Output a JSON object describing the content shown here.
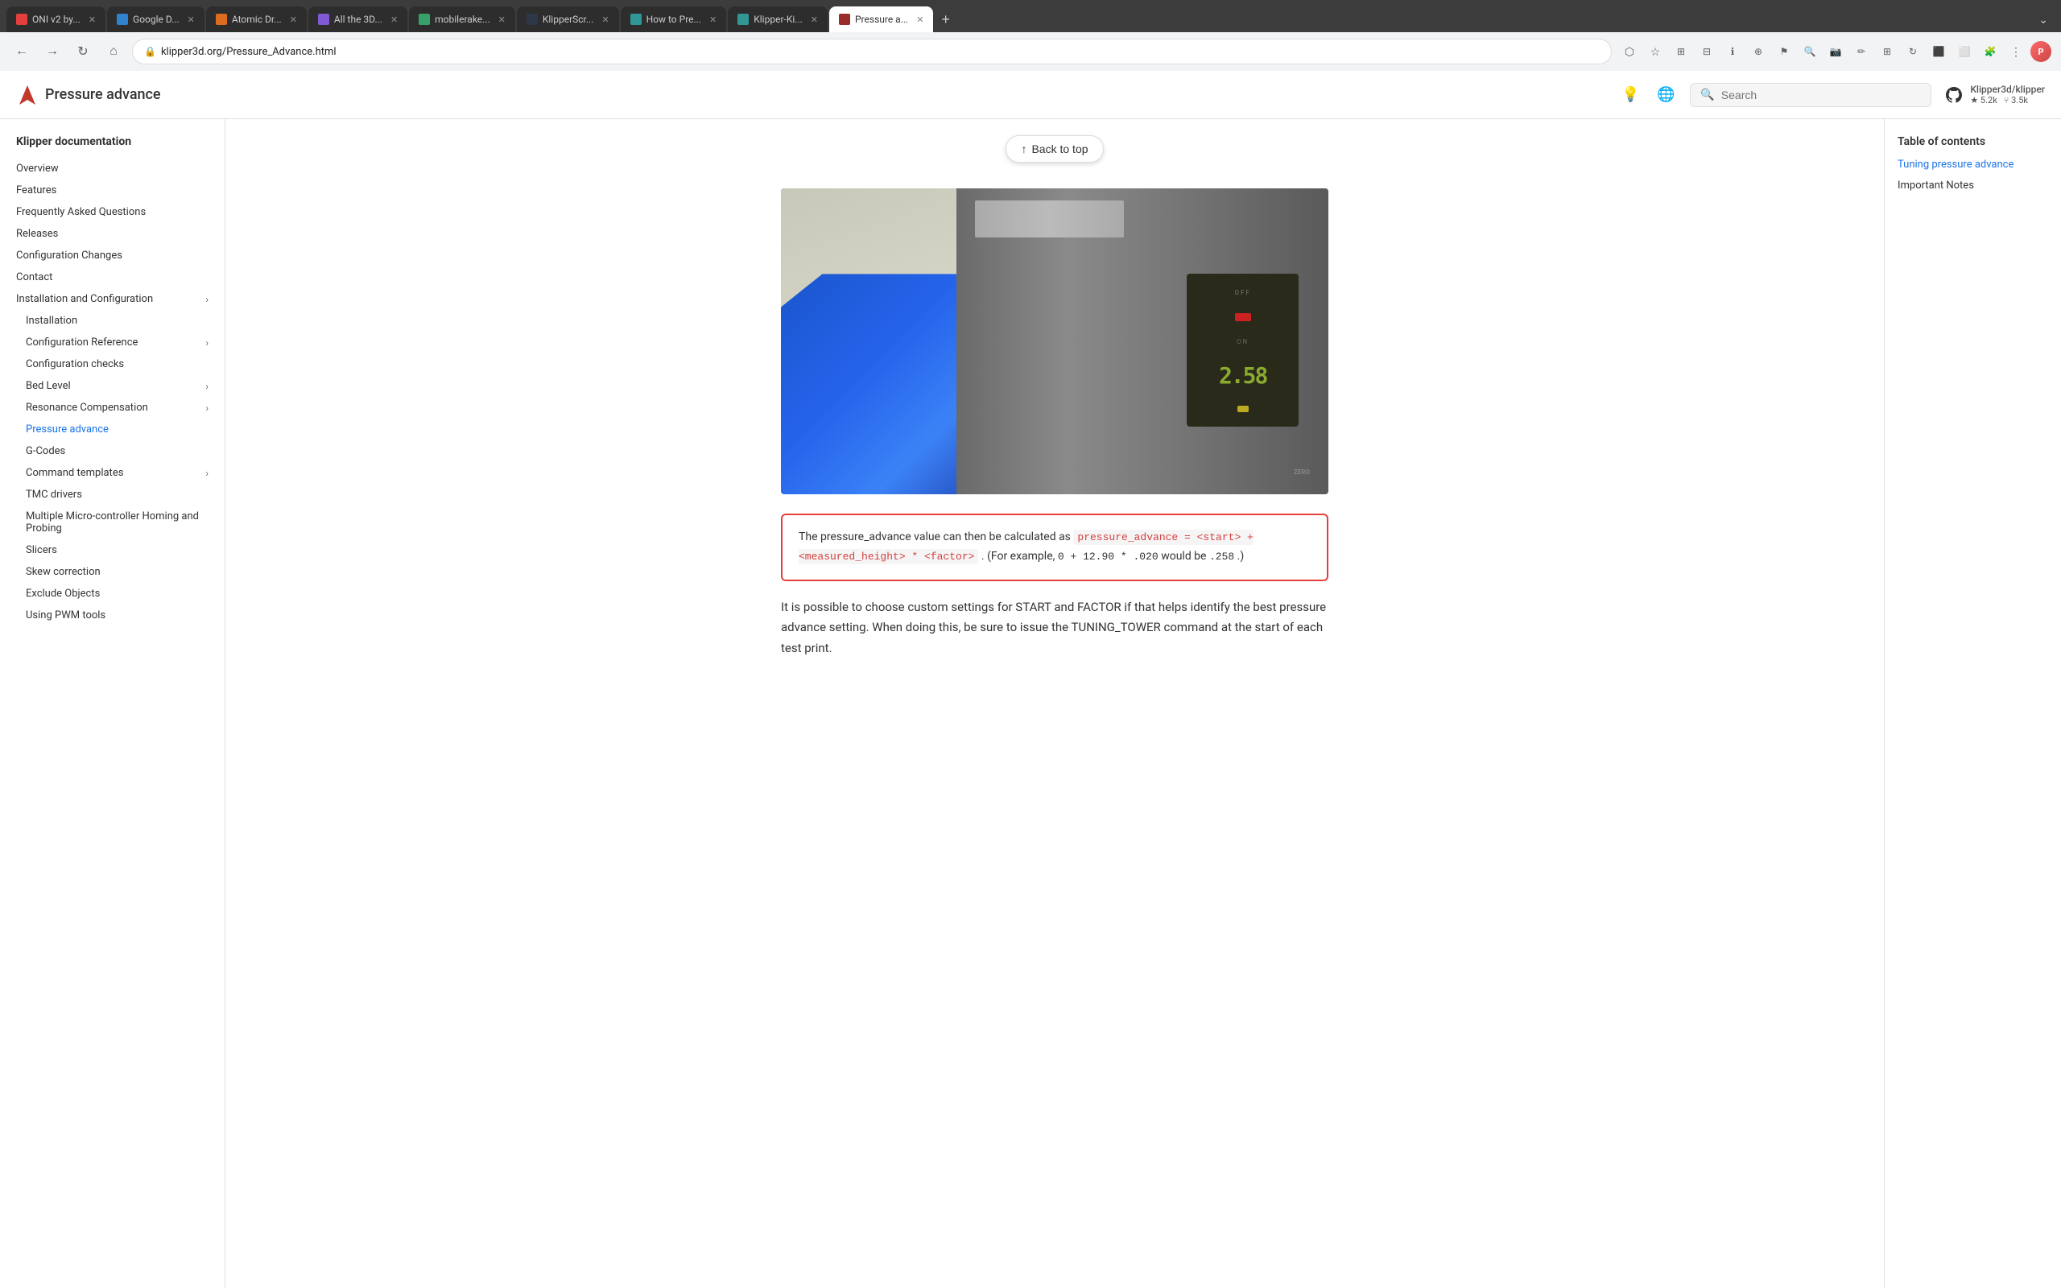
{
  "browser": {
    "tabs": [
      {
        "id": "tab-1",
        "label": "ONI v2 by...",
        "favicon_color": "#e53e3e",
        "active": false
      },
      {
        "id": "tab-2",
        "label": "Google D...",
        "favicon_color": "#3182ce",
        "active": false
      },
      {
        "id": "tab-3",
        "label": "Atomic Dr...",
        "favicon_color": "#dd6b20",
        "active": false
      },
      {
        "id": "tab-4",
        "label": "All the 3D...",
        "favicon_color": "#805ad5",
        "active": false
      },
      {
        "id": "tab-5",
        "label": "mobilerake...",
        "favicon_color": "#38a169",
        "active": false
      },
      {
        "id": "tab-6",
        "label": "KlipperScr...",
        "favicon_color": "#2d3748",
        "active": false
      },
      {
        "id": "tab-7",
        "label": "How to Pre...",
        "favicon_color": "#319795",
        "active": false
      },
      {
        "id": "tab-8",
        "label": "Klipper-Ki...",
        "favicon_color": "#319795",
        "active": false
      },
      {
        "id": "tab-9",
        "label": "Pressure a...",
        "favicon_color": "#9b2c2c",
        "active": true
      }
    ],
    "address": "klipper3d.org/Pressure_Advance.html",
    "new_tab_label": "+",
    "dropdown_label": "⌄"
  },
  "header": {
    "logo_text": "Klipper",
    "site_title": "Pressure advance",
    "search_placeholder": "Search",
    "github_user": "Klipper3d/klipper",
    "github_stars": "★ 5.2k",
    "github_forks": "⑂ 3.5k",
    "theme_icon": "💡",
    "lang_icon": "🌐"
  },
  "sidebar": {
    "section_title": "Klipper documentation",
    "items": [
      {
        "label": "Overview",
        "indent": 0,
        "has_chevron": false,
        "active": false
      },
      {
        "label": "Features",
        "indent": 0,
        "has_chevron": false,
        "active": false
      },
      {
        "label": "Frequently Asked Questions",
        "indent": 0,
        "has_chevron": false,
        "active": false
      },
      {
        "label": "Releases",
        "indent": 0,
        "has_chevron": false,
        "active": false
      },
      {
        "label": "Configuration Changes",
        "indent": 0,
        "has_chevron": false,
        "active": false
      },
      {
        "label": "Contact",
        "indent": 0,
        "has_chevron": false,
        "active": false
      },
      {
        "label": "Installation and Configuration",
        "indent": 0,
        "has_chevron": true,
        "active": false
      },
      {
        "label": "Installation",
        "indent": 1,
        "has_chevron": false,
        "active": false
      },
      {
        "label": "Configuration Reference",
        "indent": 1,
        "has_chevron": true,
        "active": false
      },
      {
        "label": "Configuration checks",
        "indent": 1,
        "has_chevron": false,
        "active": false
      },
      {
        "label": "Bed Level",
        "indent": 1,
        "has_chevron": true,
        "active": false
      },
      {
        "label": "Resonance Compensation",
        "indent": 1,
        "has_chevron": true,
        "active": false
      },
      {
        "label": "Pressure advance",
        "indent": 1,
        "has_chevron": false,
        "active": true
      },
      {
        "label": "G-Codes",
        "indent": 1,
        "has_chevron": false,
        "active": false
      },
      {
        "label": "Command templates",
        "indent": 1,
        "has_chevron": true,
        "active": false
      },
      {
        "label": "TMC drivers",
        "indent": 1,
        "has_chevron": false,
        "active": false
      },
      {
        "label": "Multiple Micro-controller Homing and Probing",
        "indent": 1,
        "has_chevron": false,
        "active": false
      },
      {
        "label": "Slicers",
        "indent": 1,
        "has_chevron": false,
        "active": false
      },
      {
        "label": "Skew correction",
        "indent": 1,
        "has_chevron": false,
        "active": false
      },
      {
        "label": "Exclude Objects",
        "indent": 1,
        "has_chevron": false,
        "active": false
      },
      {
        "label": "Using PWM tools",
        "indent": 1,
        "has_chevron": false,
        "active": false
      }
    ]
  },
  "toc": {
    "title": "Table of contents",
    "items": [
      {
        "label": "Tuning pressure advance",
        "link": true
      },
      {
        "label": "Important Notes",
        "link": false
      }
    ]
  },
  "main": {
    "back_to_top": "Back to top",
    "formula_text_before": "The pressure_advance value can then be calculated as",
    "formula_code": "pressure_advance = <start> + <measured_height> * <factor>",
    "formula_text_mid": ". (For example,",
    "formula_example": "0 + 12.90 * .020",
    "formula_text_after": "would be",
    "formula_result": ".258",
    "formula_end": ".)",
    "body_text": "It is possible to choose custom settings for START and FACTOR if that helps identify the best pressure advance setting. When doing this, be sure to issue the TUNING_TOWER command at the start of each test print."
  }
}
